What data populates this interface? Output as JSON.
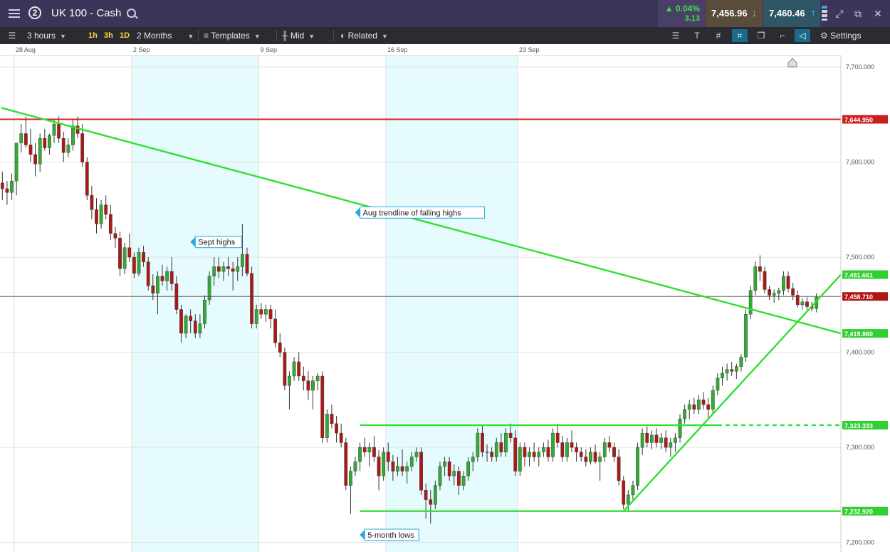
{
  "header": {
    "window_number": "2",
    "instrument": "UK 100 - Cash",
    "change_pct": "0.04%",
    "change_abs": "3.13",
    "sell_price": "7,456.96",
    "buy_price": "7,460.46"
  },
  "toolbar": {
    "interval": "3 hours",
    "quick_1": "1h",
    "quick_2": "3h",
    "quick_3": "1D",
    "range": "2 Months",
    "templates": "Templates",
    "price_mode": "Mid",
    "related": "Related",
    "settings": "Settings"
  },
  "colors": {
    "accent_header": "#3d3459",
    "toolbar_bg": "#2b2b32",
    "bull": "#33aa33",
    "bear": "#aa1a1a",
    "trendline": "#2fe02f",
    "resistance": "#d42020",
    "band": "#e6fbfd"
  },
  "chart_data": {
    "type": "candlestick",
    "timeframe_hours": 3,
    "x_tick_labels": [
      "28 Aug",
      "2 Sep",
      "9 Sep",
      "16 Sep",
      "23 Sep"
    ],
    "y_tick_labels": [
      "7,700.000",
      "7,600.000",
      "7,500.000",
      "7,400.000",
      "7,300.000",
      "7,200.000"
    ],
    "ylim": [
      7190,
      7712
    ],
    "level_labels": {
      "resistance": "7,644.950",
      "trend_high": "7,481.661",
      "current": "7,458.710",
      "trend_cross": "7,419.860",
      "range_high": "7,323.333",
      "range_low": "7,232.920"
    },
    "annotations": [
      {
        "text": "Aug trendline of falling highs",
        "x": 76,
        "y": 7547
      },
      {
        "text": "Sept highs",
        "x": 41,
        "y": 7516
      },
      {
        "text": "5-month lows",
        "x": 77,
        "y": 7208
      }
    ],
    "candles": [
      [
        7578,
        7590,
        7560,
        7572
      ],
      [
        7572,
        7580,
        7555,
        7568
      ],
      [
        7568,
        7588,
        7560,
        7580
      ],
      [
        7580,
        7620,
        7565,
        7620
      ],
      [
        7620,
        7640,
        7610,
        7630
      ],
      [
        7630,
        7648,
        7615,
        7618
      ],
      [
        7618,
        7635,
        7600,
        7608
      ],
      [
        7608,
        7620,
        7585,
        7598
      ],
      [
        7598,
        7630,
        7590,
        7625
      ],
      [
        7625,
        7635,
        7612,
        7615
      ],
      [
        7615,
        7630,
        7608,
        7628
      ],
      [
        7628,
        7645,
        7620,
        7640
      ],
      [
        7640,
        7648,
        7620,
        7625
      ],
      [
        7625,
        7632,
        7600,
        7610
      ],
      [
        7610,
        7625,
        7605,
        7618
      ],
      [
        7618,
        7645,
        7612,
        7638
      ],
      [
        7638,
        7648,
        7625,
        7630
      ],
      [
        7630,
        7640,
        7595,
        7600
      ],
      [
        7600,
        7605,
        7560,
        7565
      ],
      [
        7565,
        7575,
        7540,
        7550
      ],
      [
        7550,
        7562,
        7525,
        7535
      ],
      [
        7535,
        7560,
        7530,
        7555
      ],
      [
        7555,
        7565,
        7540,
        7545
      ],
      [
        7545,
        7555,
        7518,
        7525
      ],
      [
        7525,
        7532,
        7510,
        7520
      ],
      [
        7520,
        7527,
        7480,
        7488
      ],
      [
        7488,
        7515,
        7482,
        7510
      ],
      [
        7510,
        7525,
        7495,
        7500
      ],
      [
        7500,
        7505,
        7478,
        7483
      ],
      [
        7483,
        7510,
        7480,
        7505
      ],
      [
        7505,
        7512,
        7490,
        7495
      ],
      [
        7495,
        7500,
        7465,
        7470
      ],
      [
        7470,
        7482,
        7455,
        7462
      ],
      [
        7462,
        7485,
        7440,
        7480
      ],
      [
        7480,
        7492,
        7470,
        7475
      ],
      [
        7475,
        7490,
        7465,
        7485
      ],
      [
        7485,
        7500,
        7465,
        7472
      ],
      [
        7472,
        7480,
        7440,
        7445
      ],
      [
        7445,
        7450,
        7410,
        7420
      ],
      [
        7420,
        7440,
        7415,
        7438
      ],
      [
        7438,
        7445,
        7420,
        7433
      ],
      [
        7433,
        7440,
        7415,
        7420
      ],
      [
        7420,
        7440,
        7415,
        7430
      ],
      [
        7430,
        7460,
        7425,
        7455
      ],
      [
        7455,
        7485,
        7450,
        7480
      ],
      [
        7480,
        7500,
        7470,
        7490
      ],
      [
        7490,
        7500,
        7478,
        7485
      ],
      [
        7485,
        7495,
        7475,
        7490
      ],
      [
        7490,
        7500,
        7480,
        7488
      ],
      [
        7488,
        7495,
        7465,
        7485
      ],
      [
        7485,
        7500,
        7475,
        7490
      ],
      [
        7490,
        7535,
        7480,
        7503
      ],
      [
        7503,
        7510,
        7480,
        7483
      ],
      [
        7483,
        7490,
        7425,
        7430
      ],
      [
        7430,
        7450,
        7425,
        7445
      ],
      [
        7445,
        7452,
        7435,
        7440
      ],
      [
        7440,
        7450,
        7432,
        7445
      ],
      [
        7445,
        7450,
        7425,
        7435
      ],
      [
        7435,
        7445,
        7405,
        7410
      ],
      [
        7410,
        7420,
        7395,
        7400
      ],
      [
        7400,
        7405,
        7360,
        7365
      ],
      [
        7365,
        7380,
        7340,
        7375
      ],
      [
        7375,
        7395,
        7370,
        7390
      ],
      [
        7390,
        7400,
        7370,
        7375
      ],
      [
        7375,
        7385,
        7360,
        7370
      ],
      [
        7370,
        7380,
        7350,
        7360
      ],
      [
        7360,
        7375,
        7340,
        7370
      ],
      [
        7370,
        7378,
        7360,
        7375
      ],
      [
        7375,
        7380,
        7305,
        7310
      ],
      [
        7310,
        7340,
        7305,
        7335
      ],
      [
        7335,
        7345,
        7320,
        7325
      ],
      [
        7325,
        7333,
        7305,
        7315
      ],
      [
        7315,
        7325,
        7300,
        7305
      ],
      [
        7305,
        7310,
        7255,
        7260
      ],
      [
        7260,
        7280,
        7230,
        7275
      ],
      [
        7275,
        7290,
        7270,
        7285
      ],
      [
        7285,
        7305,
        7275,
        7300
      ],
      [
        7300,
        7310,
        7290,
        7295
      ],
      [
        7295,
        7305,
        7280,
        7300
      ],
      [
        7300,
        7312,
        7285,
        7290
      ],
      [
        7290,
        7297,
        7255,
        7270
      ],
      [
        7270,
        7300,
        7265,
        7295
      ],
      [
        7295,
        7305,
        7275,
        7285
      ],
      [
        7285,
        7292,
        7265,
        7275
      ],
      [
        7275,
        7290,
        7270,
        7280
      ],
      [
        7280,
        7298,
        7270,
        7275
      ],
      [
        7275,
        7285,
        7262,
        7280
      ],
      [
        7280,
        7295,
        7275,
        7290
      ],
      [
        7290,
        7300,
        7285,
        7295
      ],
      [
        7295,
        7300,
        7250,
        7255
      ],
      [
        7255,
        7262,
        7225,
        7245
      ],
      [
        7245,
        7255,
        7220,
        7240
      ],
      [
        7240,
        7265,
        7235,
        7260
      ],
      [
        7260,
        7285,
        7255,
        7280
      ],
      [
        7280,
        7290,
        7270,
        7285
      ],
      [
        7285,
        7290,
        7265,
        7270
      ],
      [
        7270,
        7282,
        7260,
        7275
      ],
      [
        7275,
        7280,
        7250,
        7260
      ],
      [
        7260,
        7275,
        7255,
        7270
      ],
      [
        7270,
        7290,
        7265,
        7285
      ],
      [
        7285,
        7295,
        7275,
        7290
      ],
      [
        7290,
        7320,
        7285,
        7315
      ],
      [
        7315,
        7323,
        7290,
        7295
      ],
      [
        7295,
        7303,
        7285,
        7295
      ],
      [
        7295,
        7300,
        7285,
        7290
      ],
      [
        7290,
        7310,
        7285,
        7305
      ],
      [
        7305,
        7315,
        7290,
        7295
      ],
      [
        7295,
        7320,
        7290,
        7315
      ],
      [
        7315,
        7325,
        7305,
        7310
      ],
      [
        7310,
        7318,
        7270,
        7275
      ],
      [
        7275,
        7305,
        7270,
        7300
      ],
      [
        7300,
        7305,
        7280,
        7290
      ],
      [
        7290,
        7300,
        7280,
        7295
      ],
      [
        7295,
        7305,
        7285,
        7290
      ],
      [
        7290,
        7300,
        7280,
        7295
      ],
      [
        7295,
        7305,
        7290,
        7300
      ],
      [
        7300,
        7308,
        7285,
        7290
      ],
      [
        7290,
        7320,
        7285,
        7315
      ],
      [
        7315,
        7325,
        7300,
        7305
      ],
      [
        7305,
        7312,
        7285,
        7290
      ],
      [
        7290,
        7310,
        7285,
        7305
      ],
      [
        7305,
        7318,
        7295,
        7300
      ],
      [
        7300,
        7305,
        7285,
        7295
      ],
      [
        7295,
        7300,
        7285,
        7290
      ],
      [
        7290,
        7298,
        7280,
        7285
      ],
      [
        7285,
        7300,
        7282,
        7295
      ],
      [
        7295,
        7303,
        7283,
        7285
      ],
      [
        7285,
        7295,
        7265,
        7290
      ],
      [
        7290,
        7310,
        7285,
        7305
      ],
      [
        7305,
        7312,
        7295,
        7300
      ],
      [
        7300,
        7305,
        7285,
        7290
      ],
      [
        7290,
        7298,
        7260,
        7265
      ],
      [
        7265,
        7270,
        7235,
        7240
      ],
      [
        7240,
        7255,
        7232,
        7250
      ],
      [
        7250,
        7265,
        7245,
        7260
      ],
      [
        7260,
        7305,
        7255,
        7300
      ],
      [
        7300,
        7320,
        7292,
        7315
      ],
      [
        7315,
        7322,
        7300,
        7305
      ],
      [
        7305,
        7318,
        7298,
        7313
      ],
      [
        7313,
        7320,
        7300,
        7305
      ],
      [
        7305,
        7315,
        7298,
        7310
      ],
      [
        7310,
        7318,
        7295,
        7300
      ],
      [
        7300,
        7310,
        7290,
        7305
      ],
      [
        7305,
        7315,
        7295,
        7310
      ],
      [
        7310,
        7335,
        7305,
        7330
      ],
      [
        7330,
        7345,
        7325,
        7340
      ],
      [
        7340,
        7350,
        7330,
        7345
      ],
      [
        7345,
        7352,
        7335,
        7340
      ],
      [
        7340,
        7355,
        7335,
        7350
      ],
      [
        7350,
        7358,
        7340,
        7345
      ],
      [
        7345,
        7352,
        7330,
        7340
      ],
      [
        7340,
        7365,
        7335,
        7360
      ],
      [
        7360,
        7378,
        7355,
        7373
      ],
      [
        7373,
        7385,
        7365,
        7378
      ],
      [
        7378,
        7388,
        7370,
        7382
      ],
      [
        7382,
        7390,
        7375,
        7380
      ],
      [
        7380,
        7388,
        7372,
        7385
      ],
      [
        7385,
        7398,
        7380,
        7395
      ],
      [
        7395,
        7445,
        7390,
        7440
      ],
      [
        7440,
        7470,
        7435,
        7465
      ],
      [
        7465,
        7495,
        7460,
        7490
      ],
      [
        7490,
        7502,
        7475,
        7485
      ],
      [
        7485,
        7490,
        7462,
        7466
      ],
      [
        7466,
        7470,
        7455,
        7460
      ],
      [
        7460,
        7466,
        7452,
        7462
      ],
      [
        7462,
        7468,
        7455,
        7465
      ],
      [
        7465,
        7485,
        7460,
        7480
      ],
      [
        7480,
        7485,
        7463,
        7467
      ],
      [
        7467,
        7473,
        7455,
        7460
      ],
      [
        7460,
        7465,
        7447,
        7450
      ],
      [
        7450,
        7457,
        7445,
        7453
      ],
      [
        7453,
        7458,
        7445,
        7448
      ],
      [
        7448,
        7453,
        7443,
        7446
      ],
      [
        7446,
        7462,
        7442,
        7458
      ]
    ]
  }
}
